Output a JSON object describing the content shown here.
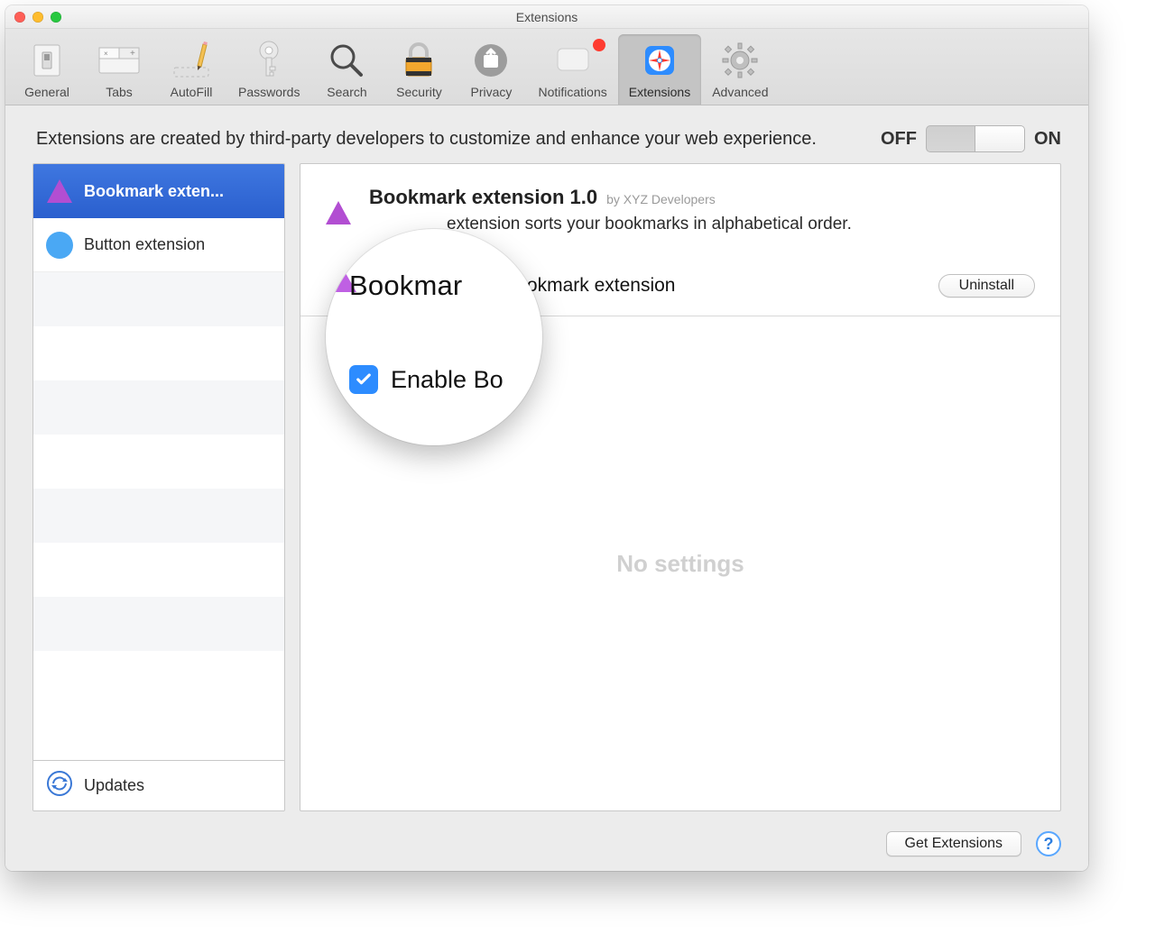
{
  "title": "Extensions",
  "toolbar": [
    {
      "label": "General"
    },
    {
      "label": "Tabs"
    },
    {
      "label": "AutoFill"
    },
    {
      "label": "Passwords"
    },
    {
      "label": "Search"
    },
    {
      "label": "Security"
    },
    {
      "label": "Privacy"
    },
    {
      "label": "Notifications"
    },
    {
      "label": "Extensions"
    },
    {
      "label": "Advanced"
    }
  ],
  "header": {
    "description": "Extensions are created by third-party developers to customize and enhance your web experience.",
    "toggle_off": "OFF",
    "toggle_on": "ON"
  },
  "sidebar": {
    "items": [
      {
        "label": "Bookmark exten..."
      },
      {
        "label": "Button extension"
      }
    ],
    "footer": "Updates"
  },
  "detail": {
    "title": "Bookmark extension 1.0",
    "by_prefix": "by ",
    "author": "XYZ Developers",
    "description": "extension sorts your bookmarks in alphabetical order.",
    "enable_label": "Enable Bookmark extension",
    "uninstall_label": "Uninstall",
    "no_settings": "No settings"
  },
  "magnifier": {
    "title": "Bookmar",
    "row_label": "Enable Bo"
  },
  "footer": {
    "get_extensions": "Get Extensions",
    "help": "?"
  }
}
